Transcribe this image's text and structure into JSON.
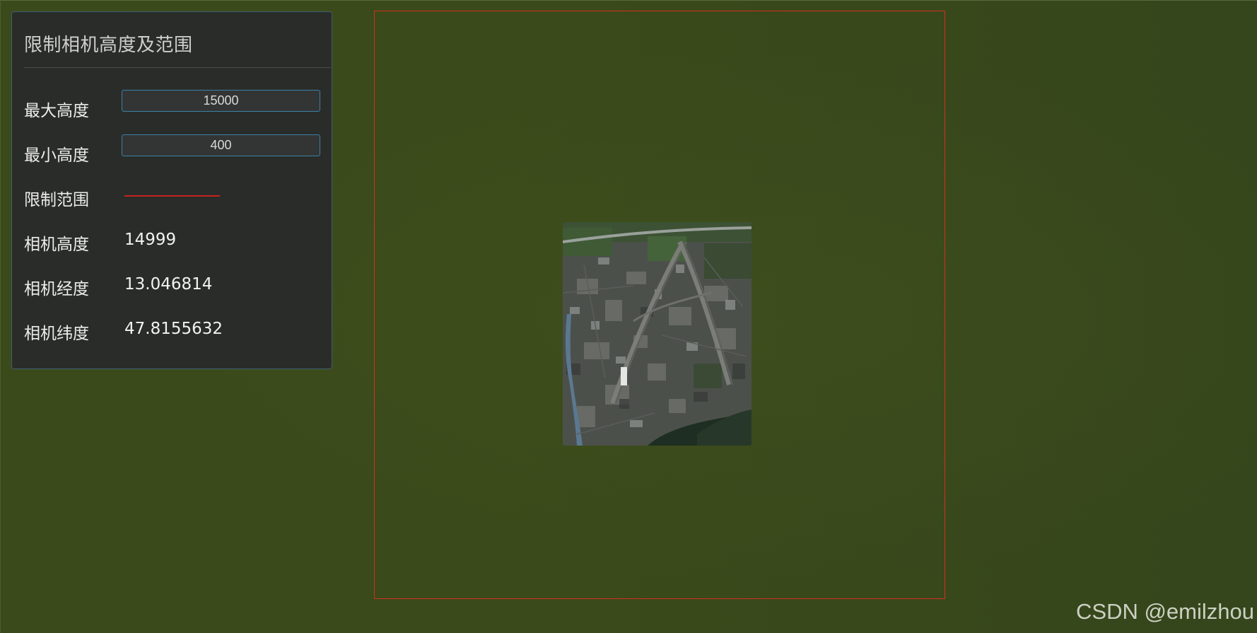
{
  "panel": {
    "title": "限制相机高度及范围",
    "max_height": {
      "label": "最大高度",
      "value": "15000"
    },
    "min_height": {
      "label": "最小高度",
      "value": "400"
    },
    "limit_range": {
      "label": "限制范围",
      "color": "#c1251c"
    },
    "camera_height": {
      "label": "相机高度",
      "value": "14999"
    },
    "camera_longitude": {
      "label": "相机经度",
      "value": "13.046814"
    },
    "camera_latitude": {
      "label": "相机纬度",
      "value": "47.8155632"
    }
  },
  "scene": {
    "terrain_color": "#3a4a1b",
    "limit_rect_color": "#d0311e"
  },
  "watermark": "CSDN @emilzhou"
}
